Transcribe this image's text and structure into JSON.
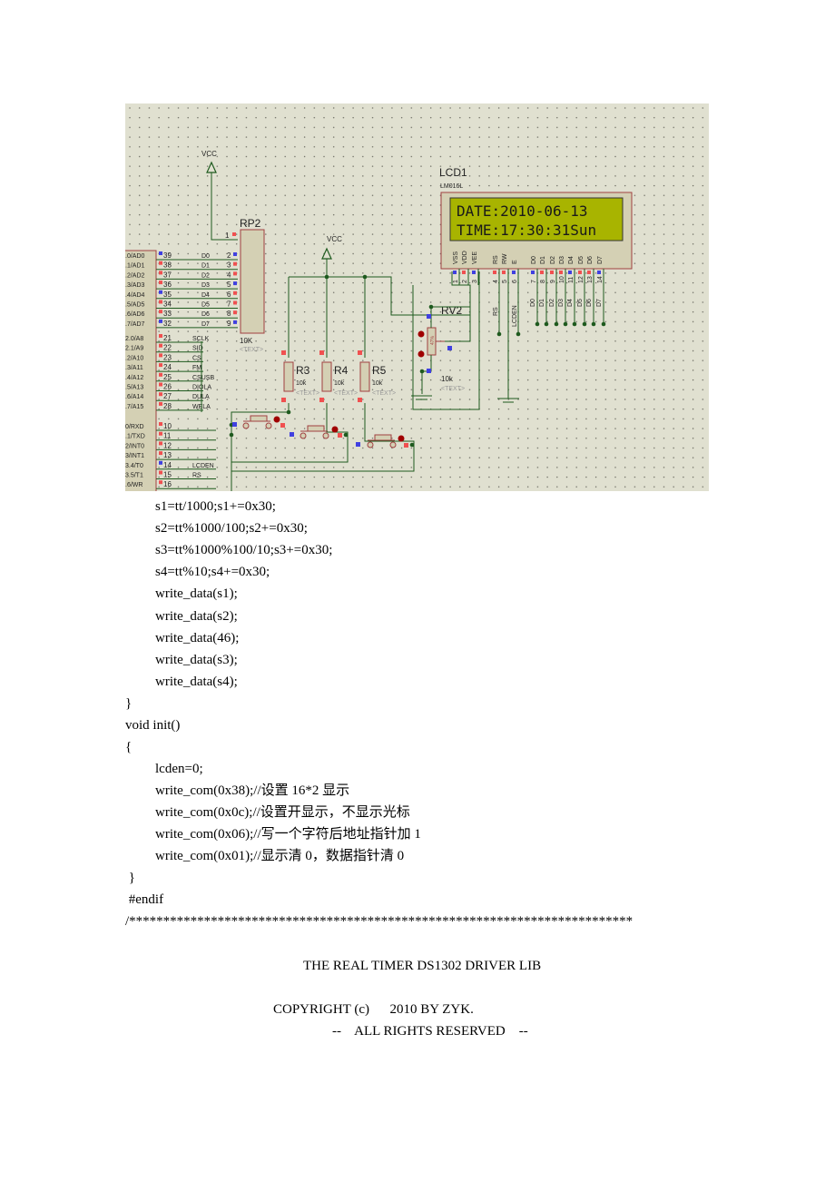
{
  "schematic": {
    "background": "#E0E0D0",
    "wire_color": "#1E5A1E",
    "component_border": "#A04040",
    "component_fill": "#D4D0B4",
    "pin_red": "#F05050",
    "pin_blue": "#4040E0",
    "lcd_bg": "#A8B400",
    "power_labels": [
      "VCC",
      "VCC"
    ],
    "rp2": {
      "name": "RP2",
      "value": "10K",
      "text": "<TEXT>",
      "pins": [
        "1",
        "2",
        "3",
        "4",
        "5",
        "6",
        "7",
        "8",
        "9"
      ]
    },
    "mcu_pins_port0": [
      {
        "label": ".0/AD0",
        "num": "39",
        "net": "D0"
      },
      {
        "label": ".1/AD1",
        "num": "38",
        "net": "D1"
      },
      {
        "label": ".2/AD2",
        "num": "37",
        "net": "D2"
      },
      {
        "label": ".3/AD3",
        "num": "36",
        "net": "D3"
      },
      {
        "label": ".4/AD4",
        "num": "35",
        "net": "D4"
      },
      {
        "label": ".5/AD5",
        "num": "34",
        "net": "D5"
      },
      {
        "label": ".6/AD6",
        "num": "33",
        "net": "D6"
      },
      {
        "label": ".7/AD7",
        "num": "32",
        "net": "D7"
      }
    ],
    "mcu_pins_port2": [
      {
        "label": "2.0/A8",
        "num": "21",
        "net": "SCLK"
      },
      {
        "label": "2.1/A9",
        "num": "22",
        "net": "SID"
      },
      {
        "label": ".2/A10",
        "num": "23",
        "net": "CS"
      },
      {
        "label": ".3/A11",
        "num": "24",
        "net": "FM"
      },
      {
        "label": ".4/A12",
        "num": "25",
        "net": "CSUSB"
      },
      {
        "label": ".5/A13",
        "num": "26",
        "net": "DIOLA"
      },
      {
        "label": ".6/A14",
        "num": "27",
        "net": "DULA"
      },
      {
        "label": ".7/A15",
        "num": "28",
        "net": "WELA"
      }
    ],
    "mcu_pins_port3": [
      {
        "label": "0/RXD",
        "num": "10",
        "net": ""
      },
      {
        "label": ".1/TXD",
        "num": "11",
        "net": ""
      },
      {
        "label": "2/INT0",
        "num": "12",
        "net": ""
      },
      {
        "label": "3/INT1",
        "num": "13",
        "net": ""
      },
      {
        "label": "3.4/T0",
        "num": "14",
        "net": "LCDEN"
      },
      {
        "label": "3.5/T1",
        "num": "15",
        "net": "RS"
      },
      {
        "label": ".6/WR",
        "num": "16",
        "net": ""
      }
    ],
    "resistors": [
      {
        "name": "R3",
        "value": "10k",
        "text": "<TEXT>"
      },
      {
        "name": "R4",
        "value": "10k",
        "text": "<TEXT>"
      },
      {
        "name": "R5",
        "value": "10k",
        "text": "<TEXT>"
      }
    ],
    "rv2": {
      "name": "RV2",
      "value": "10k",
      "text": "<TEXT>",
      "percent": "47%"
    },
    "lcd": {
      "name": "LCD1",
      "model": "LM016L",
      "text": "<TEXT>",
      "line1": "DATE:2010-06-13",
      "line2": "TIME:17:30:31Sun",
      "pin_labels": [
        "VSS",
        "VDD",
        "VEE",
        "RS",
        "RW",
        "E",
        "D0",
        "D1",
        "D2",
        "D3",
        "D4",
        "D5",
        "D6",
        "D7"
      ],
      "pin_numbers": [
        "1",
        "2",
        "3",
        "4",
        "5",
        "6",
        "7",
        "8",
        "9",
        "10",
        "11",
        "12",
        "13",
        "14"
      ],
      "net_labels": [
        "RS",
        "LCDEN",
        "D0",
        "D1",
        "D2",
        "D3",
        "D4",
        "D5",
        "D6",
        "D7"
      ]
    }
  },
  "code": {
    "lines": [
      "s1=tt/1000;s1+=0x30;",
      "s2=tt%1000/100;s2+=0x30;",
      "s3=tt%1000%100/10;s3+=0x30;",
      "s4=tt%10;s4+=0x30;",
      "write_data(s1);",
      "write_data(s2);",
      "write_data(46);",
      "write_data(s3);",
      "write_data(s4);",
      "}",
      "void init()",
      "{",
      "lcden=0;",
      "write_com(0x38);//设置 16*2 显示",
      "write_com(0x0c);//设置开显示，不显示光标",
      "write_com(0x06);//写一个字符后地址指针加 1",
      "write_com(0x01);//显示清 0，数据指针清 0",
      " }",
      " #endif",
      "/**************************************************************************"
    ],
    "header_title": "THE REAL TIMER DS1302 DRIVER LIB",
    "copyright": "COPYRIGHT (c)      2010 BY ZYK.",
    "rights": "--    ALL RIGHTS RESERVED    --"
  }
}
